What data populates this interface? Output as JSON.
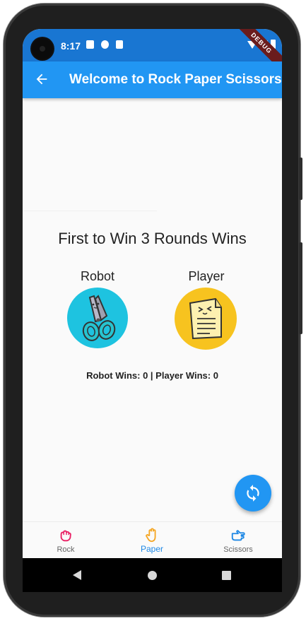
{
  "status_bar": {
    "time": "8:17",
    "debug_ribbon": "DEBUG"
  },
  "app_bar": {
    "title": "Welcome to Rock Paper Scissors!",
    "back_icon": "arrow-back-icon"
  },
  "game": {
    "headline": "First to Win 3 Rounds Wins",
    "robot_label": "Robot",
    "player_label": "Player",
    "robot_choice_icon": "scissors-icon",
    "player_choice_icon": "paper-icon",
    "score_text": "Robot Wins: 0 | Player Wins: 0"
  },
  "fab": {
    "icon": "refresh-icon"
  },
  "bottom_nav": {
    "items": [
      {
        "label": "Rock",
        "icon": "hand-fist-icon",
        "color": "#e91e63"
      },
      {
        "label": "Paper",
        "icon": "hand-open-icon",
        "color": "#f5a623"
      },
      {
        "label": "Scissors",
        "icon": "hand-peace-icon",
        "color": "#1e88e5"
      }
    ],
    "selected": "Paper"
  },
  "colors": {
    "app_bar": "#2196f3",
    "status_bar": "#1976d2",
    "accent": "#1e88e5",
    "robot_bg": "#1ec3e0",
    "player_bg": "#f7c31f"
  }
}
